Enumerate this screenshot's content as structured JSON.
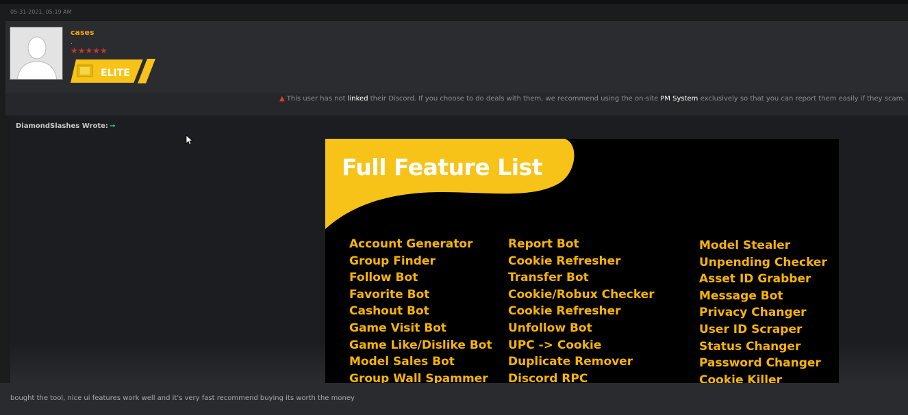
{
  "post": {
    "date": "05-31-2021, 05:19 AM",
    "author": {
      "username": "cases",
      "usertitle": ".",
      "stars": "★★★★★",
      "rank_badge": "ELITE"
    }
  },
  "discord_notice": {
    "icon": "warning-icon",
    "prefix": "This user has not ",
    "linked": "linked",
    "middle": " their Discord. If you choose to do deals with them, we recommend using the on-site ",
    "pm_system": "PM System",
    "suffix": " exclusively so that you can report them easily if they scam."
  },
  "quote": {
    "author_label": "DiamondSlashes Wrote:",
    "arrow_icon": "→",
    "image": {
      "title": "Full Feature List",
      "columns": [
        [
          "Account Generator",
          "Group Finder",
          "Follow Bot",
          "Favorite Bot",
          "Cashout Bot",
          "Game Visit Bot",
          "Game Like/Dislike Bot",
          "Model Sales Bot",
          "Group Wall Spammer"
        ],
        [
          "Report Bot",
          "Cookie Refresher",
          "Transfer Bot",
          "Cookie/Robux Checker",
          "Cookie Refresher",
          "Unfollow Bot",
          "UPC -> Cookie",
          "Duplicate Remover",
          "Discord RPC"
        ],
        [
          "Model Stealer",
          "Unpending Checker",
          "Asset ID Grabber",
          "Message Bot",
          "Privacy Changer",
          "User ID Scraper",
          "Status Changer",
          "Password Changer",
          "Cookie Killer"
        ]
      ]
    }
  },
  "reply": {
    "text": "bought the tool, nice ui features work well and it's very fast recommend buying its worth the money"
  },
  "colors": {
    "username": "#f1a50f",
    "badge_yellow": "#f7c318",
    "feature_yellow": "#f7b500",
    "warning": "#e03b2f",
    "arrow": "#3cc47c"
  }
}
